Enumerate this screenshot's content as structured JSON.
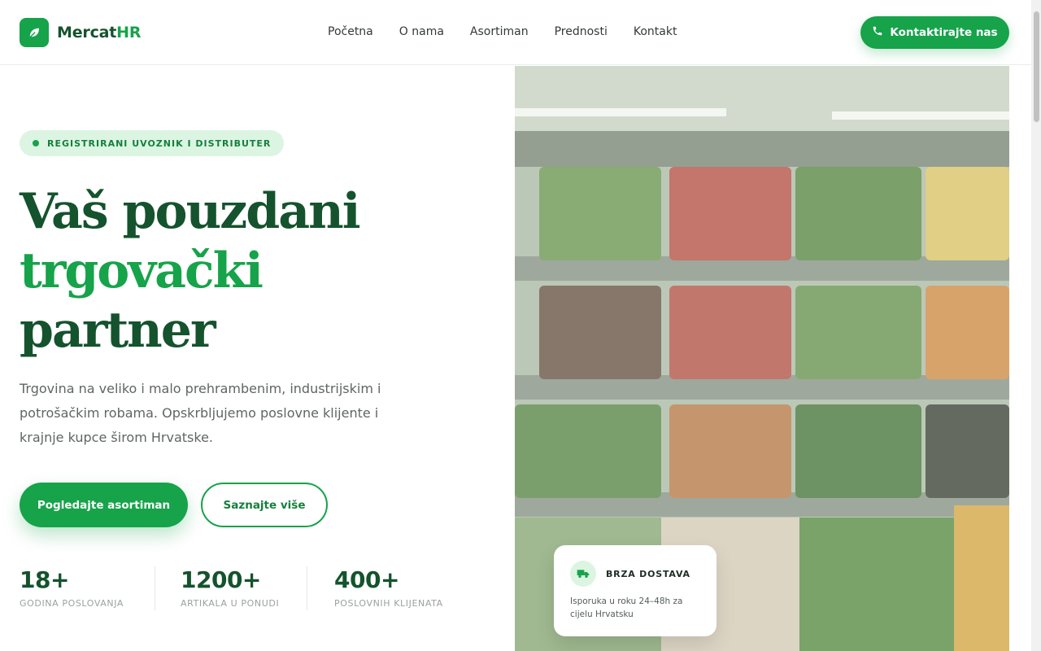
{
  "header": {
    "logo_part1": "Mercat",
    "logo_part2": "HR",
    "logo_icon": "leaf-icon",
    "nav": [
      {
        "label": "Početna"
      },
      {
        "label": "O nama"
      },
      {
        "label": "Asortiman"
      },
      {
        "label": "Prednosti"
      },
      {
        "label": "Kontakt"
      }
    ],
    "cta_label": "Kontaktirajte nas",
    "cta_icon": "phone-icon"
  },
  "hero": {
    "badge": "REGISTRIRANI UVOZNIK I DISTRIBUTER",
    "title_line1": "Vaš pouzdani",
    "title_line2": "trgovački",
    "title_line3": "partner",
    "description": "Trgovina na veliko i malo prehrambenim, industrijskim i potrošačkim robama. Opskrbljujemo poslovne klijente i krajnje kupce širom Hrvatske.",
    "primary_button": "Pogledajte asortiman",
    "secondary_button": "Saznajte više",
    "stats": [
      {
        "value": "18+",
        "label": "GODINA POSLOVANJA"
      },
      {
        "value": "1200+",
        "label": "ARTIKALA U PONUDI"
      },
      {
        "value": "400+",
        "label": "POSLOVNIH KLIJENATA"
      }
    ]
  },
  "delivery_card": {
    "icon": "truck-icon",
    "title": "BRZA DOSTAVA",
    "text": "Isporuka u roku 24–48h za cijelu Hrvatsku"
  },
  "colors": {
    "brand": "#16a34a",
    "brand_dark": "#14532d",
    "badge_bg": "#dcf5e3"
  }
}
